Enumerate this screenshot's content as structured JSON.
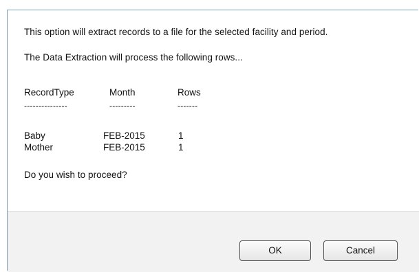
{
  "dialog": {
    "intro_text": "This option will extract records to a file for the selected facility and period.",
    "process_text": "The Data Extraction will process the following rows...",
    "table": {
      "headers": {
        "record_type": "RecordType",
        "month": "Month",
        "rows": "Rows"
      },
      "separators": {
        "record_type": "---------------",
        "month": "---------",
        "rows": "-------"
      },
      "rows": [
        {
          "record_type": "Baby",
          "month": "FEB-2015",
          "rows": "1"
        },
        {
          "record_type": "Mother",
          "month": "FEB-2015",
          "rows": "1"
        }
      ]
    },
    "prompt_text": "Do you wish to proceed?",
    "buttons": {
      "ok_label": "OK",
      "cancel_label": "Cancel"
    }
  }
}
